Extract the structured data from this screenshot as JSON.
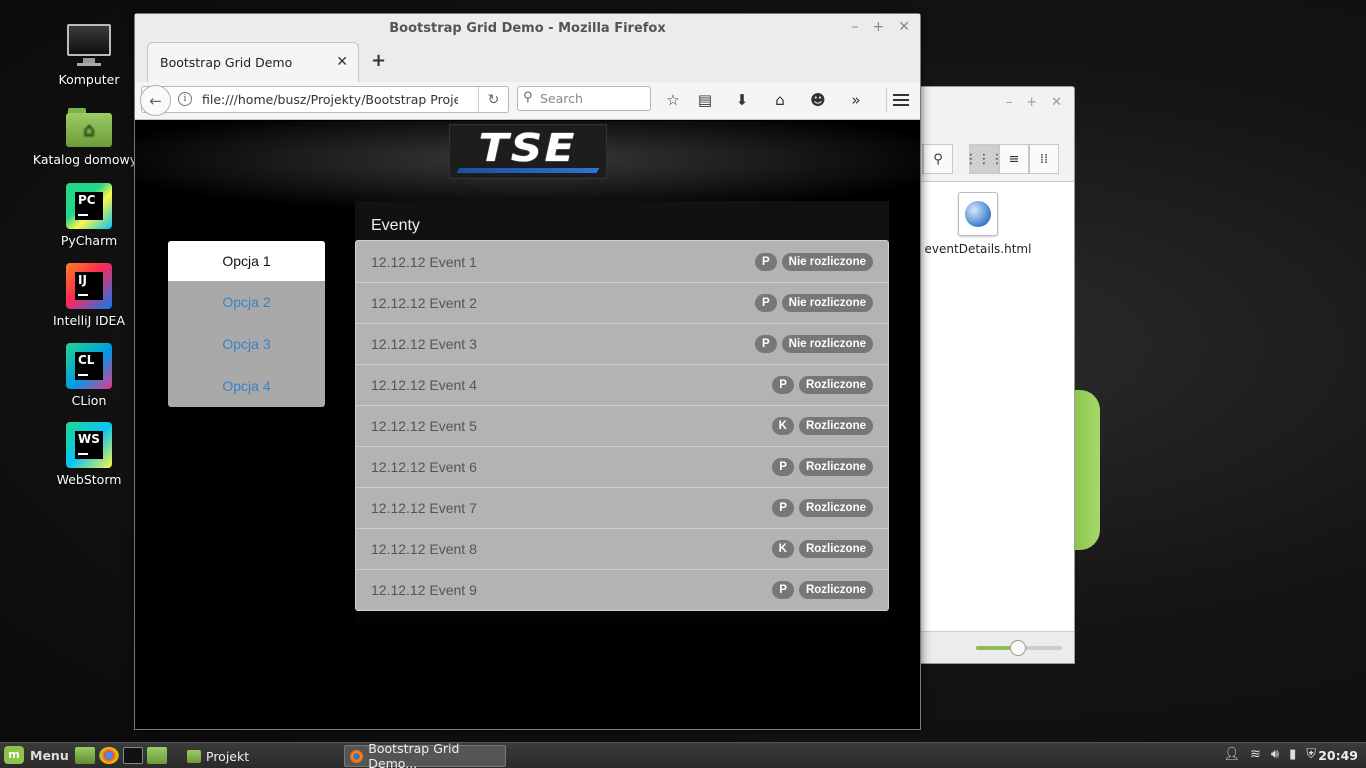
{
  "desktop": {
    "icons": [
      {
        "label": "Komputer",
        "icon": "computer-icon"
      },
      {
        "label": "Katalog domowy",
        "icon": "home-folder-icon"
      },
      {
        "label": "PyCharm",
        "icon": "pycharm-icon",
        "abbr": "PC"
      },
      {
        "label": "IntelliJ IDEA",
        "icon": "intellij-icon",
        "abbr": "IJ"
      },
      {
        "label": "CLion",
        "icon": "clion-icon",
        "abbr": "CL"
      },
      {
        "label": "WebStorm",
        "icon": "webstorm-icon",
        "abbr": "WS"
      }
    ]
  },
  "file_manager": {
    "file_name": "eventDetails.html",
    "zoom_fraction": 0.49
  },
  "browser": {
    "window_title": "Bootstrap Grid Demo - Mozilla Firefox",
    "tab_title": "Bootstrap Grid Demo",
    "url": "file:///home/busz/Projekty/Bootstrap Projects",
    "search_placeholder": "Search"
  },
  "page": {
    "logo_text": "TSE",
    "section_title": "Eventy",
    "menu": [
      {
        "label": "Opcja 1",
        "active": true
      },
      {
        "label": "Opcja 2",
        "active": false
      },
      {
        "label": "Opcja 3",
        "active": false
      },
      {
        "label": "Opcja 4",
        "active": false
      }
    ],
    "events": [
      {
        "name": "12.12.12 Event 1",
        "type": "P",
        "status": "Nie rozliczone"
      },
      {
        "name": "12.12.12 Event 2",
        "type": "P",
        "status": "Nie rozliczone"
      },
      {
        "name": "12.12.12 Event 3",
        "type": "P",
        "status": "Nie rozliczone"
      },
      {
        "name": "12.12.12 Event 4",
        "type": "P",
        "status": "Rozliczone"
      },
      {
        "name": "12.12.12 Event 5",
        "type": "K",
        "status": "Rozliczone"
      },
      {
        "name": "12.12.12 Event 6",
        "type": "P",
        "status": "Rozliczone"
      },
      {
        "name": "12.12.12 Event 7",
        "type": "P",
        "status": "Rozliczone"
      },
      {
        "name": "12.12.12 Event 8",
        "type": "K",
        "status": "Rozliczone"
      },
      {
        "name": "12.12.12 Event 9",
        "type": "P",
        "status": "Rozliczone"
      }
    ]
  },
  "taskbar": {
    "menu_label": "Menu",
    "tasks": [
      {
        "label": "Projekt",
        "active": false
      },
      {
        "label": "Bootstrap Grid Demo...",
        "active": true
      }
    ],
    "clock": "20:49"
  },
  "colors": {
    "link": "#3a82c8",
    "badge": "#777777",
    "list_bg": "#b3b3b3",
    "mint_green": "#8ac54a"
  }
}
